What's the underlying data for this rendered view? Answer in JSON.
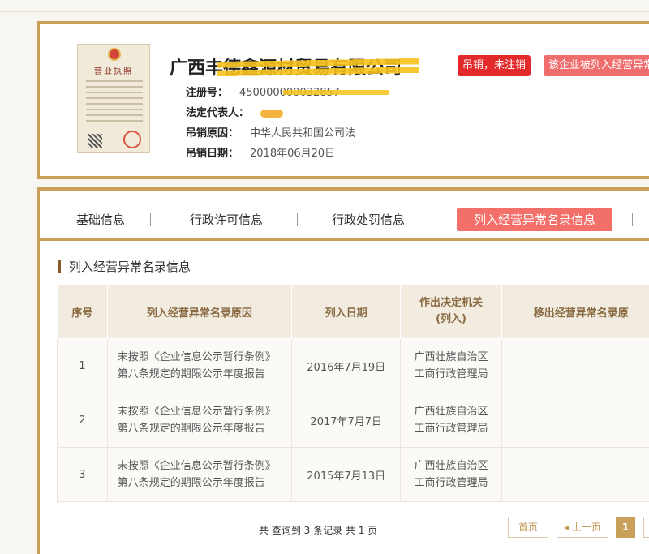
{
  "header": {
    "license_title": "营业执照",
    "company_name": "广西丰德鑫源材贸易有限公司",
    "badge_status": "吊销，未注销",
    "badge_abnormal": "该企业被列入经营异常",
    "reg_no_label": "注册号：",
    "reg_no_value": "450000000032857",
    "legal_rep_label": "法定代表人：",
    "revoke_reason_label": "吊销原因：",
    "revoke_reason_value": "中华人民共和国公司法",
    "revoke_date_label": "吊销日期：",
    "revoke_date_value": "2018年06月20日"
  },
  "tabs": [
    "基础信息",
    "行政许可信息",
    "行政处罚信息",
    "列入经营异常名录信息"
  ],
  "section_title": "列入经营异常名录信息",
  "table": {
    "headers": [
      "序号",
      "列入经营异常名录原因",
      "列入日期",
      "作出决定机关\n(列入)",
      "移出经营异常名录原"
    ],
    "rows": [
      {
        "no": "1",
        "reason_line1": "未按照《企业信息公示暂行条例》",
        "reason_line2": "第八条规定的期限公示年度报告",
        "date": "2016年7月19日",
        "org_line1": "广西壮族自治区",
        "org_line2": "工商行政管理局",
        "removal": ""
      },
      {
        "no": "2",
        "reason_line1": "未按照《企业信息公示暂行条例》",
        "reason_line2": "第八条规定的期限公示年度报告",
        "date": "2017年7月7日",
        "org_line1": "广西壮族自治区",
        "org_line2": "工商行政管理局",
        "removal": ""
      },
      {
        "no": "3",
        "reason_line1": "未按照《企业信息公示暂行条例》",
        "reason_line2": "第八条规定的期限公示年度报告",
        "date": "2015年7月13日",
        "org_line1": "广西壮族自治区",
        "org_line2": "工商行政管理局",
        "removal": ""
      }
    ]
  },
  "pager": {
    "summary": "共 查询到 3 条记录 共 1 页",
    "first": "首页",
    "prev": "◂ 上一页",
    "current": "1"
  },
  "colors": {
    "gold": "#c8a05a",
    "red_badge": "#e32a2a",
    "pink_badge": "#f06d6d",
    "active_tab": "#f36f6a"
  }
}
